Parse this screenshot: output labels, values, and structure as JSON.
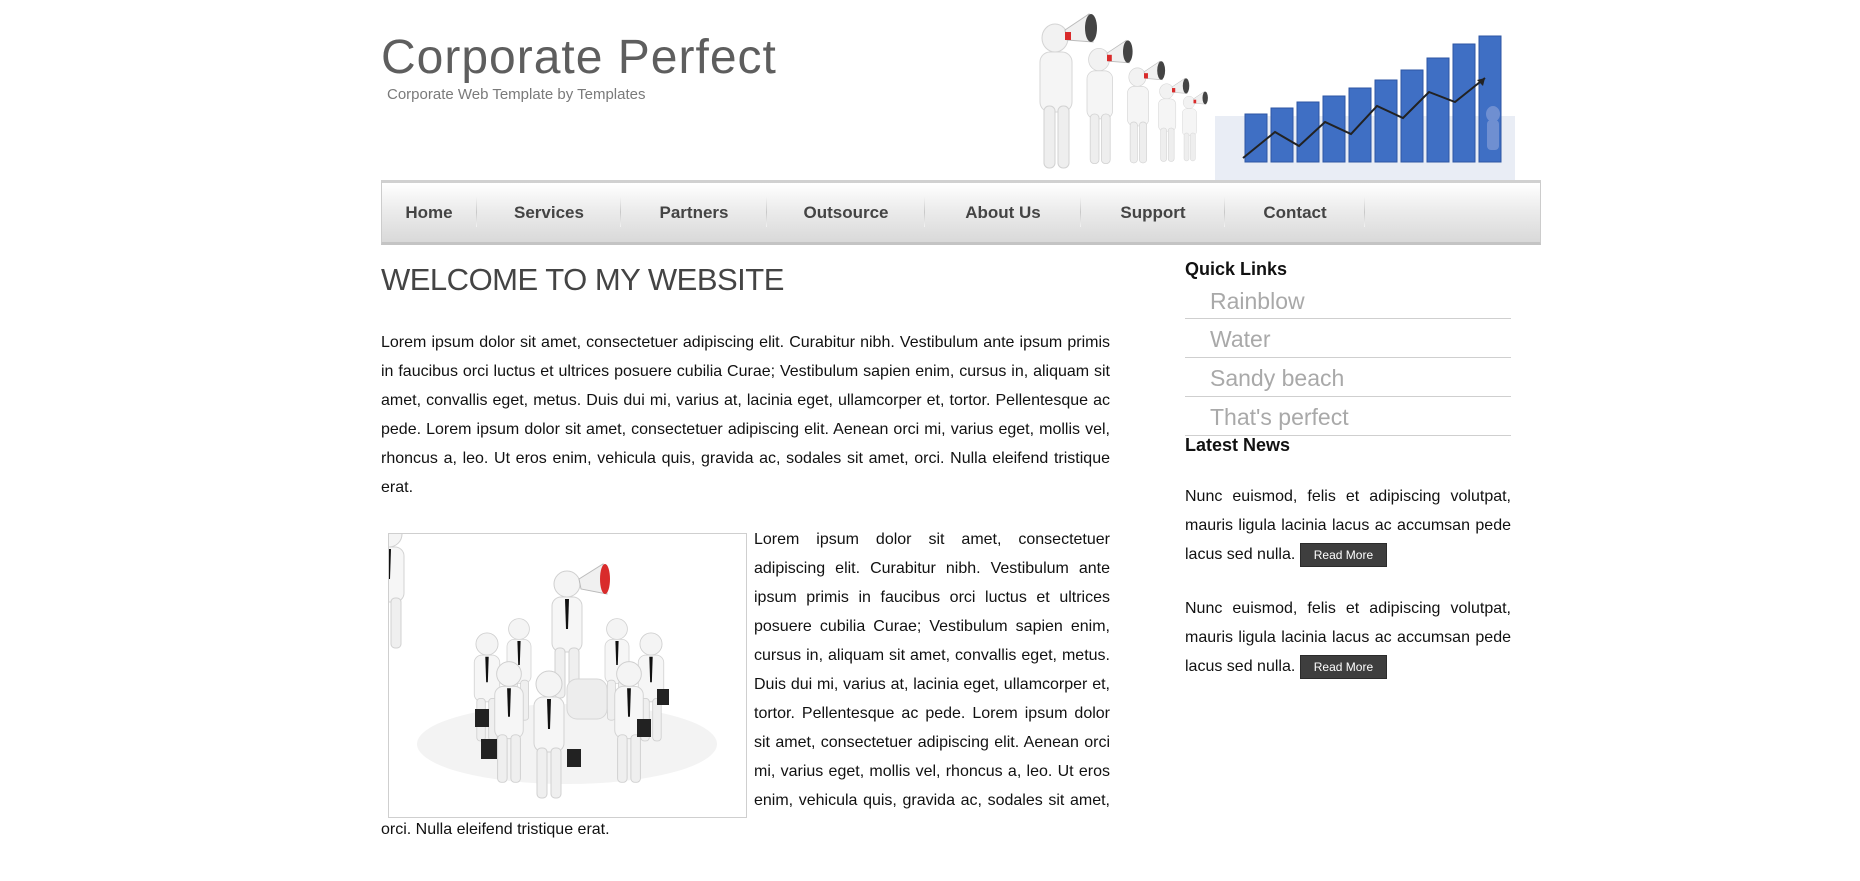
{
  "header": {
    "title": "Corporate Perfect",
    "subtitle": "Corporate Web Template by Templates"
  },
  "nav": {
    "items": [
      {
        "label": "Home"
      },
      {
        "label": "Services"
      },
      {
        "label": "Partners"
      },
      {
        "label": "Outsource"
      },
      {
        "label": "About Us"
      },
      {
        "label": "Support"
      },
      {
        "label": "Contact"
      }
    ]
  },
  "main": {
    "heading": "WELCOME TO MY WEBSITE",
    "paragraph1": "Lorem ipsum dolor sit amet, consectetuer adipiscing elit. Curabitur nibh. Vestibulum ante ipsum primis in faucibus orci luctus et ultrices posuere cubilia Curae; Vestibulum sapien enim, cursus in, aliquam sit amet, convallis eget, metus. Duis dui mi, varius at, lacinia eget, ullamcorper et, tortor. Pellentesque ac pede. Lorem ipsum dolor sit amet, consectetuer adipiscing elit. Aenean orci mi, varius eget, mollis vel, rhoncus a, leo. Ut eros enim, vehicula quis, gravida ac, sodales sit amet, orci. Nulla eleifend tristique erat.",
    "paragraph2": "Lorem ipsum dolor sit amet, consectetuer adipiscing elit. Curabitur nibh. Vestibulum ante ipsum primis in faucibus orci luctus et ultrices posuere cubilia Curae; Vestibulum sapien enim, cursus in, aliquam sit amet, convallis eget, metus. Duis dui mi, varius at, lacinia eget, ullamcorper et, tortor. Pellentesque ac pede. Lorem ipsum dolor sit amet, consectetuer adipiscing elit. Aenean orci mi, varius eget, mollis vel, rhoncus a, leo. Ut eros enim, vehicula quis, gravida ac, sodales sit amet, orci. Nulla eleifend tristique erat."
  },
  "sidebar": {
    "quick_links_heading": "Quick Links",
    "quick_links": [
      {
        "label": "Rainblow"
      },
      {
        "label": "Water"
      },
      {
        "label": "Sandy beach"
      },
      {
        "label": "That's perfect"
      }
    ],
    "latest_news_heading": "Latest News",
    "news": [
      {
        "text": "Nunc euismod, felis et adipiscing volutpat, mauris ligula lacinia lacus ac accumsan pede lacus sed nulla.",
        "button": "Read More"
      },
      {
        "text": "Nunc euismod, felis et adipiscing volutpat, mauris ligula lacinia lacus ac accumsan pede lacus sed nulla.",
        "button": "Read More"
      }
    ]
  },
  "colors": {
    "title_gray": "#5e5e5e",
    "nav_text": "#444444",
    "quick_link_text": "#a9a9a9",
    "button_bg": "#3e3e3e",
    "chart_blue": "#3f6fc4",
    "megaphone_red": "#d92b2b"
  },
  "icons": {
    "header_left_art": "people-with-megaphones-illustration",
    "header_right_art": "rising-bar-chart-illustration",
    "content_image": "team-meeting-megaphone-illustration"
  }
}
